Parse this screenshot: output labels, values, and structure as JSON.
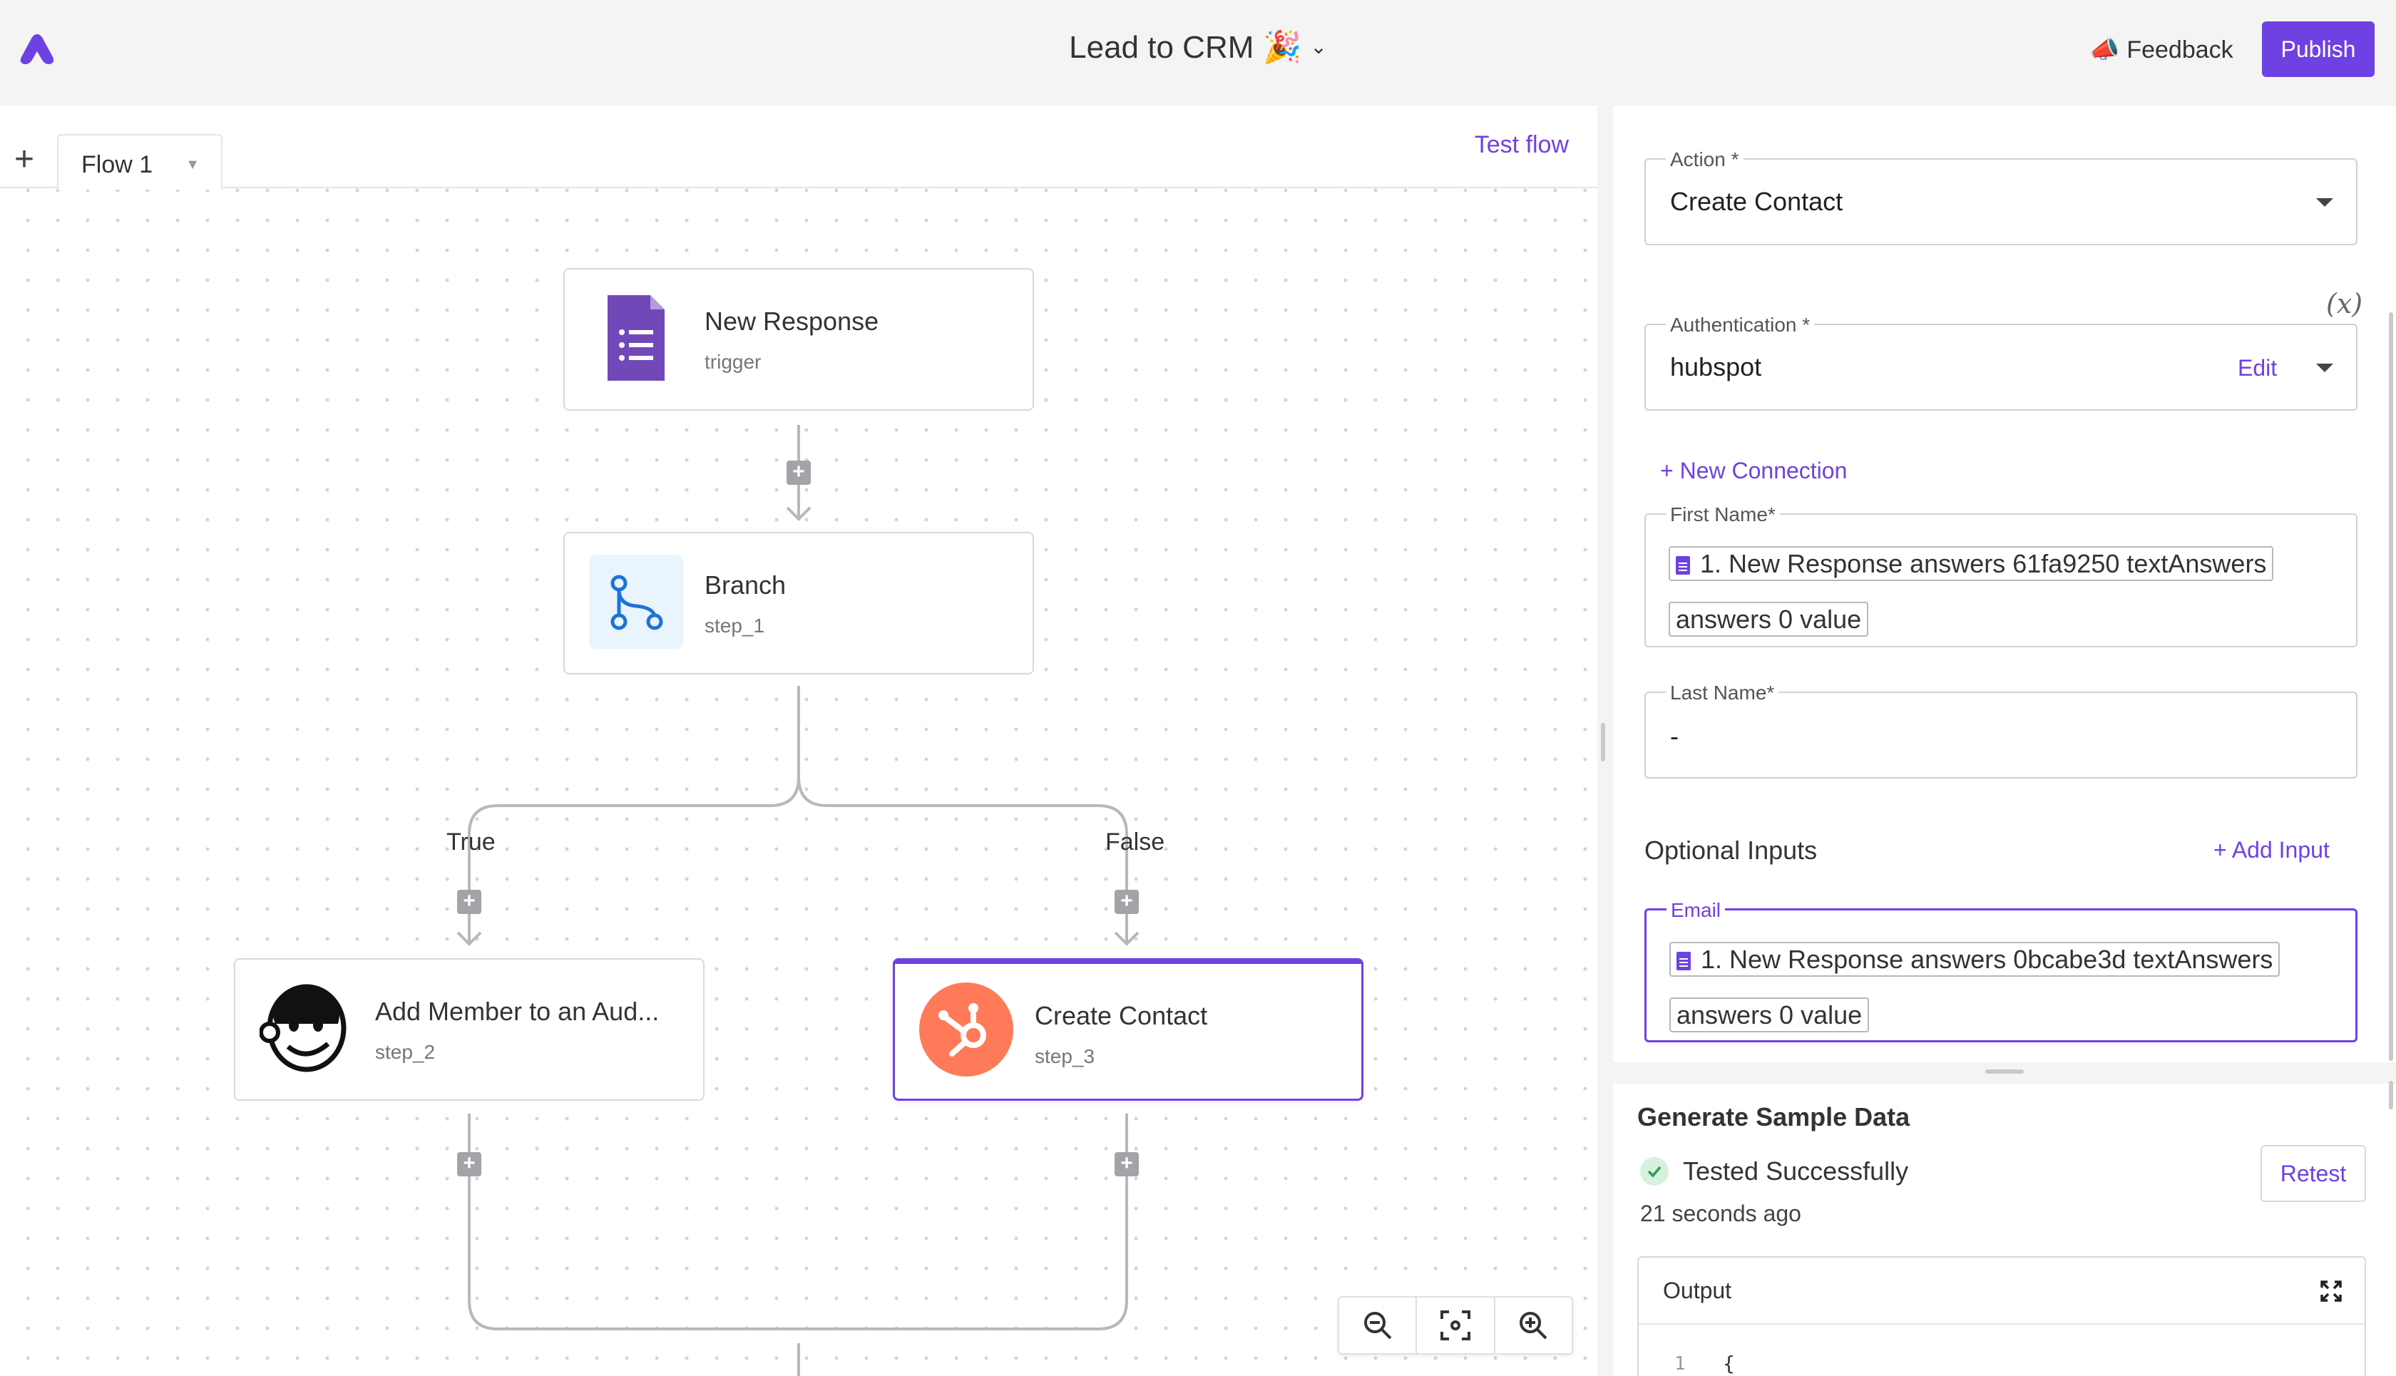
{
  "header": {
    "title": "Lead to CRM 🎉",
    "feedback_label": "Feedback",
    "feedback_icon": "📣",
    "publish_label": "Publish",
    "accent_color": "#6e41e2"
  },
  "canvas": {
    "tab_label": "Flow 1",
    "test_flow_label": "Test flow",
    "nodes": [
      {
        "title": "New Response",
        "subtitle": "trigger",
        "icon": "google-forms-icon"
      },
      {
        "title": "Branch",
        "subtitle": "step_1",
        "icon": "branch-icon"
      },
      {
        "title": "Add Member to an Aud...",
        "subtitle": "step_2",
        "icon": "mailchimp-icon"
      },
      {
        "title": "Create Contact",
        "subtitle": "step_3",
        "icon": "hubspot-icon"
      }
    ],
    "branch_true_label": "True",
    "branch_false_label": "False"
  },
  "panel": {
    "action": {
      "label": "Action *",
      "value": "Create Contact"
    },
    "auth": {
      "label": "Authentication *",
      "value": "hubspot",
      "edit_label": "Edit"
    },
    "var_toggle": "(x)",
    "new_connection": "+ New Connection",
    "first_name": {
      "label": "First Name*",
      "chip": "1. New Response answers 61fa9250 textAnswers answers 0 value"
    },
    "last_name": {
      "label": "Last Name*",
      "value": "-"
    },
    "optional_inputs": "Optional Inputs",
    "add_input": "+ Add Input",
    "email": {
      "label": "Email",
      "chip": "1. New Response answers 0bcabe3d textAnswers answers 0 value"
    },
    "sample": {
      "title": "Generate Sample Data",
      "status": "Tested Successfully",
      "ago": "21 seconds ago",
      "retest_label": "Retest",
      "output_label": "Output",
      "line_number": "1",
      "code_first_line": "{"
    }
  }
}
